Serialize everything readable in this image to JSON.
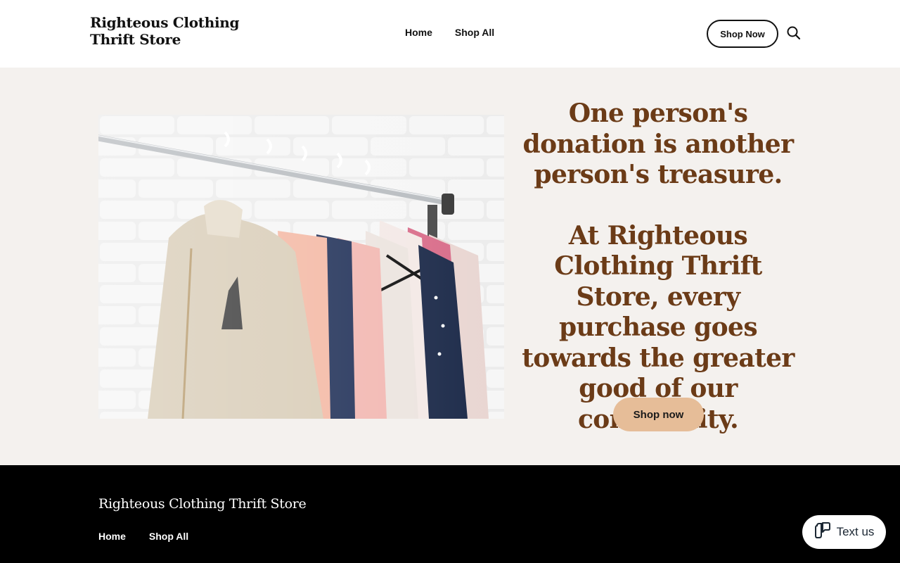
{
  "header": {
    "brand": "Righteous Clothing Thrift Store",
    "nav": [
      "Home",
      "Shop All"
    ],
    "cta_label": "Shop Now",
    "search_icon": "search-icon"
  },
  "hero": {
    "image_desc": "clothing-rack-image",
    "headline": "One person's donation is another person's treasure.",
    "body": "At Righteous Clothing Thrift Store, every purchase goes towards the greater good of our community.",
    "cta_label": "Shop now",
    "accent_color": "#6b3b17",
    "button_color": "#e6bd98"
  },
  "footer": {
    "brand": "Righteous Clothing Thrift Store",
    "nav": [
      "Home",
      "Shop All"
    ]
  },
  "chat_widget": {
    "label": "Text us",
    "icon": "chat-bubble-icon"
  }
}
